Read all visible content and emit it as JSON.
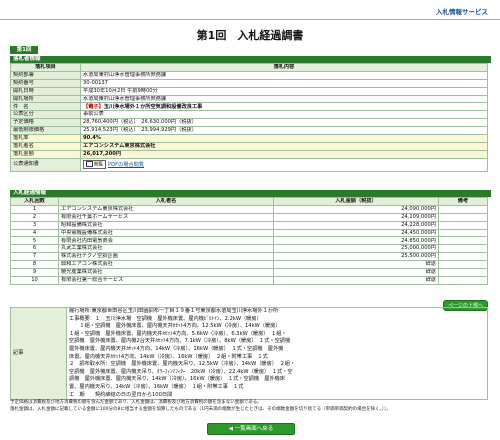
{
  "header": {
    "service": "入札情報サービス",
    "title": "第1回　入札経過調書"
  },
  "tab_label": "第1回",
  "summary": {
    "section": "落札者情報",
    "head_item": "落札項目",
    "head_content": "落札内容",
    "rows": [
      {
        "label": "契約部署",
        "value": "水道局東村山浄水管理事務所庶務課"
      },
      {
        "label": "契約番号",
        "value": "30-00137"
      },
      {
        "label": "開札日時",
        "value": "平成30年10月2日 午前9時00分"
      },
      {
        "label": "開札場所",
        "value": "水道局東村山浄水管理事務所庶務課"
      },
      {
        "label": "件　名",
        "value": "玉川浄水場外１か所空気調和設備改良工事",
        "tag": "【電子】"
      },
      {
        "label": "公表区分",
        "value": "事前公表"
      },
      {
        "label": "予定価格",
        "value": "28,760,400円（税込）　26,630,000円（税抜）"
      },
      {
        "label": "最低制限価格",
        "value": "25,914,523円（税込）　23,994,929円（税抜）"
      },
      {
        "label": "落札率",
        "value": "90.4%"
      },
      {
        "label": "落札者名",
        "value": "エアコンシステム東京株式会社"
      },
      {
        "label": "落札金額",
        "value": "26,017,200円"
      },
      {
        "label": "公表通知書",
        "value": "公表通知書",
        "button": "閲覧",
        "link": "PDFの場合閲覧"
      }
    ]
  },
  "bids": {
    "section": "入札経過情報",
    "headers": [
      "入札回数",
      "入札者名",
      "入札金額（税抜）",
      "備考"
    ],
    "rows": [
      {
        "no": "1",
        "name": "エアコンシステム東京株式会社",
        "amount": "24,090,000円",
        "note": ""
      },
      {
        "no": "2",
        "name": "有限会社千葉ホームサービス",
        "amount": "24,109,000円",
        "note": ""
      },
      {
        "no": "3",
        "name": "昭和設備株式会社",
        "amount": "24,228,000円",
        "note": ""
      },
      {
        "no": "4",
        "name": "中央電機設備株式会社",
        "amount": "24,450,000円",
        "note": ""
      },
      {
        "no": "5",
        "name": "有限会社内田電気商会",
        "amount": "24,850,000円",
        "note": ""
      },
      {
        "no": "6",
        "name": "丸武工業株式会社",
        "amount": "25,000,000円",
        "note": ""
      },
      {
        "no": "7",
        "name": "株式会社テクノ空調企画",
        "amount": "25,500,000円",
        "note": ""
      },
      {
        "no": "8",
        "name": "興和エアコン株式会社",
        "amount": "辞退",
        "note": ""
      },
      {
        "no": "9",
        "name": "暁光産業株式会社",
        "amount": "辞退",
        "note": ""
      },
      {
        "no": "10",
        "name": "有限会社第一総合サービス",
        "amount": "辞退",
        "note": ""
      }
    ]
  },
  "page_top_button": "ページの上部へ",
  "remarks": {
    "label": "記事",
    "lines": [
      "履行場所:東京都世田谷区玉川田園調布一丁目１９番１号東京都水道局玉川浄水場外１か所",
      "工事概要：１　玉川浄水場　空調機　屋外機床置、屋内機ﾋﾞﾙﾄｲﾝ、2.2kW（暖房）",
      "　　１組・空調機　屋外機床置、屋内機天井ｶｾｯﾄ4方向、12.5kW（冷房）、14kW（暖房）",
      "１組・空調機　屋外機床置、屋内機天井ｶｾｯﾄ4方向、5.6kW（冷房）、6.3kW（暖房）　１組・",
      "空調機　屋外機床置、屋内機2台天井ｶｾｯﾄ4方向、7.1kW（冷房）、8kW（暖房）　１式・空調機",
      "屋外機床置、屋内機天井ｶｾｯﾄ4方向、14kW（冷房）、16kW（暖房）　１式・空調機　屋外機",
      "床置、屋内機天井ｶｾｯﾄ4方向、14kW（冷房）、16kW（暖房）　２組・附帯工事　１式",
      "２　調布取水所：空調機　屋外機床置、屋内機天吊り、12.5kW（冷房）、14kW（暖房）　２組・",
      "空調機　屋外機床置、屋内機天吊り、ﾀﾜｰﾌｨﾝﾏﾌｨﾀｰ　20kW（冷房）、22.4kW（暖房）　１式・空",
      "調機　屋外機床置、屋内機天吊り、14kW（冷房）、16kW（暖房）　１式・空調機　屋外機床",
      "置、屋内機天吊り、14kW（冷房）、16kW（暖房）　１組・附帯工事　１式",
      "工　期　　契約締結の日の翌日から100日間"
    ]
  },
  "notes": [
    "予定価格は消費税及び地方消費税の額を含んだ金額であり、入札金額は、消費税及び地方消費税の額を含まない金額である。",
    "落札金額は、入札金額に記載している金額に100分の8に相当する金額を加算したものである（1円未満の端数が生じたときは、その端数金額を切り捨てる（単価単価契約の場合を除く。））。"
  ],
  "back_button": "一覧画面へ戻る"
}
